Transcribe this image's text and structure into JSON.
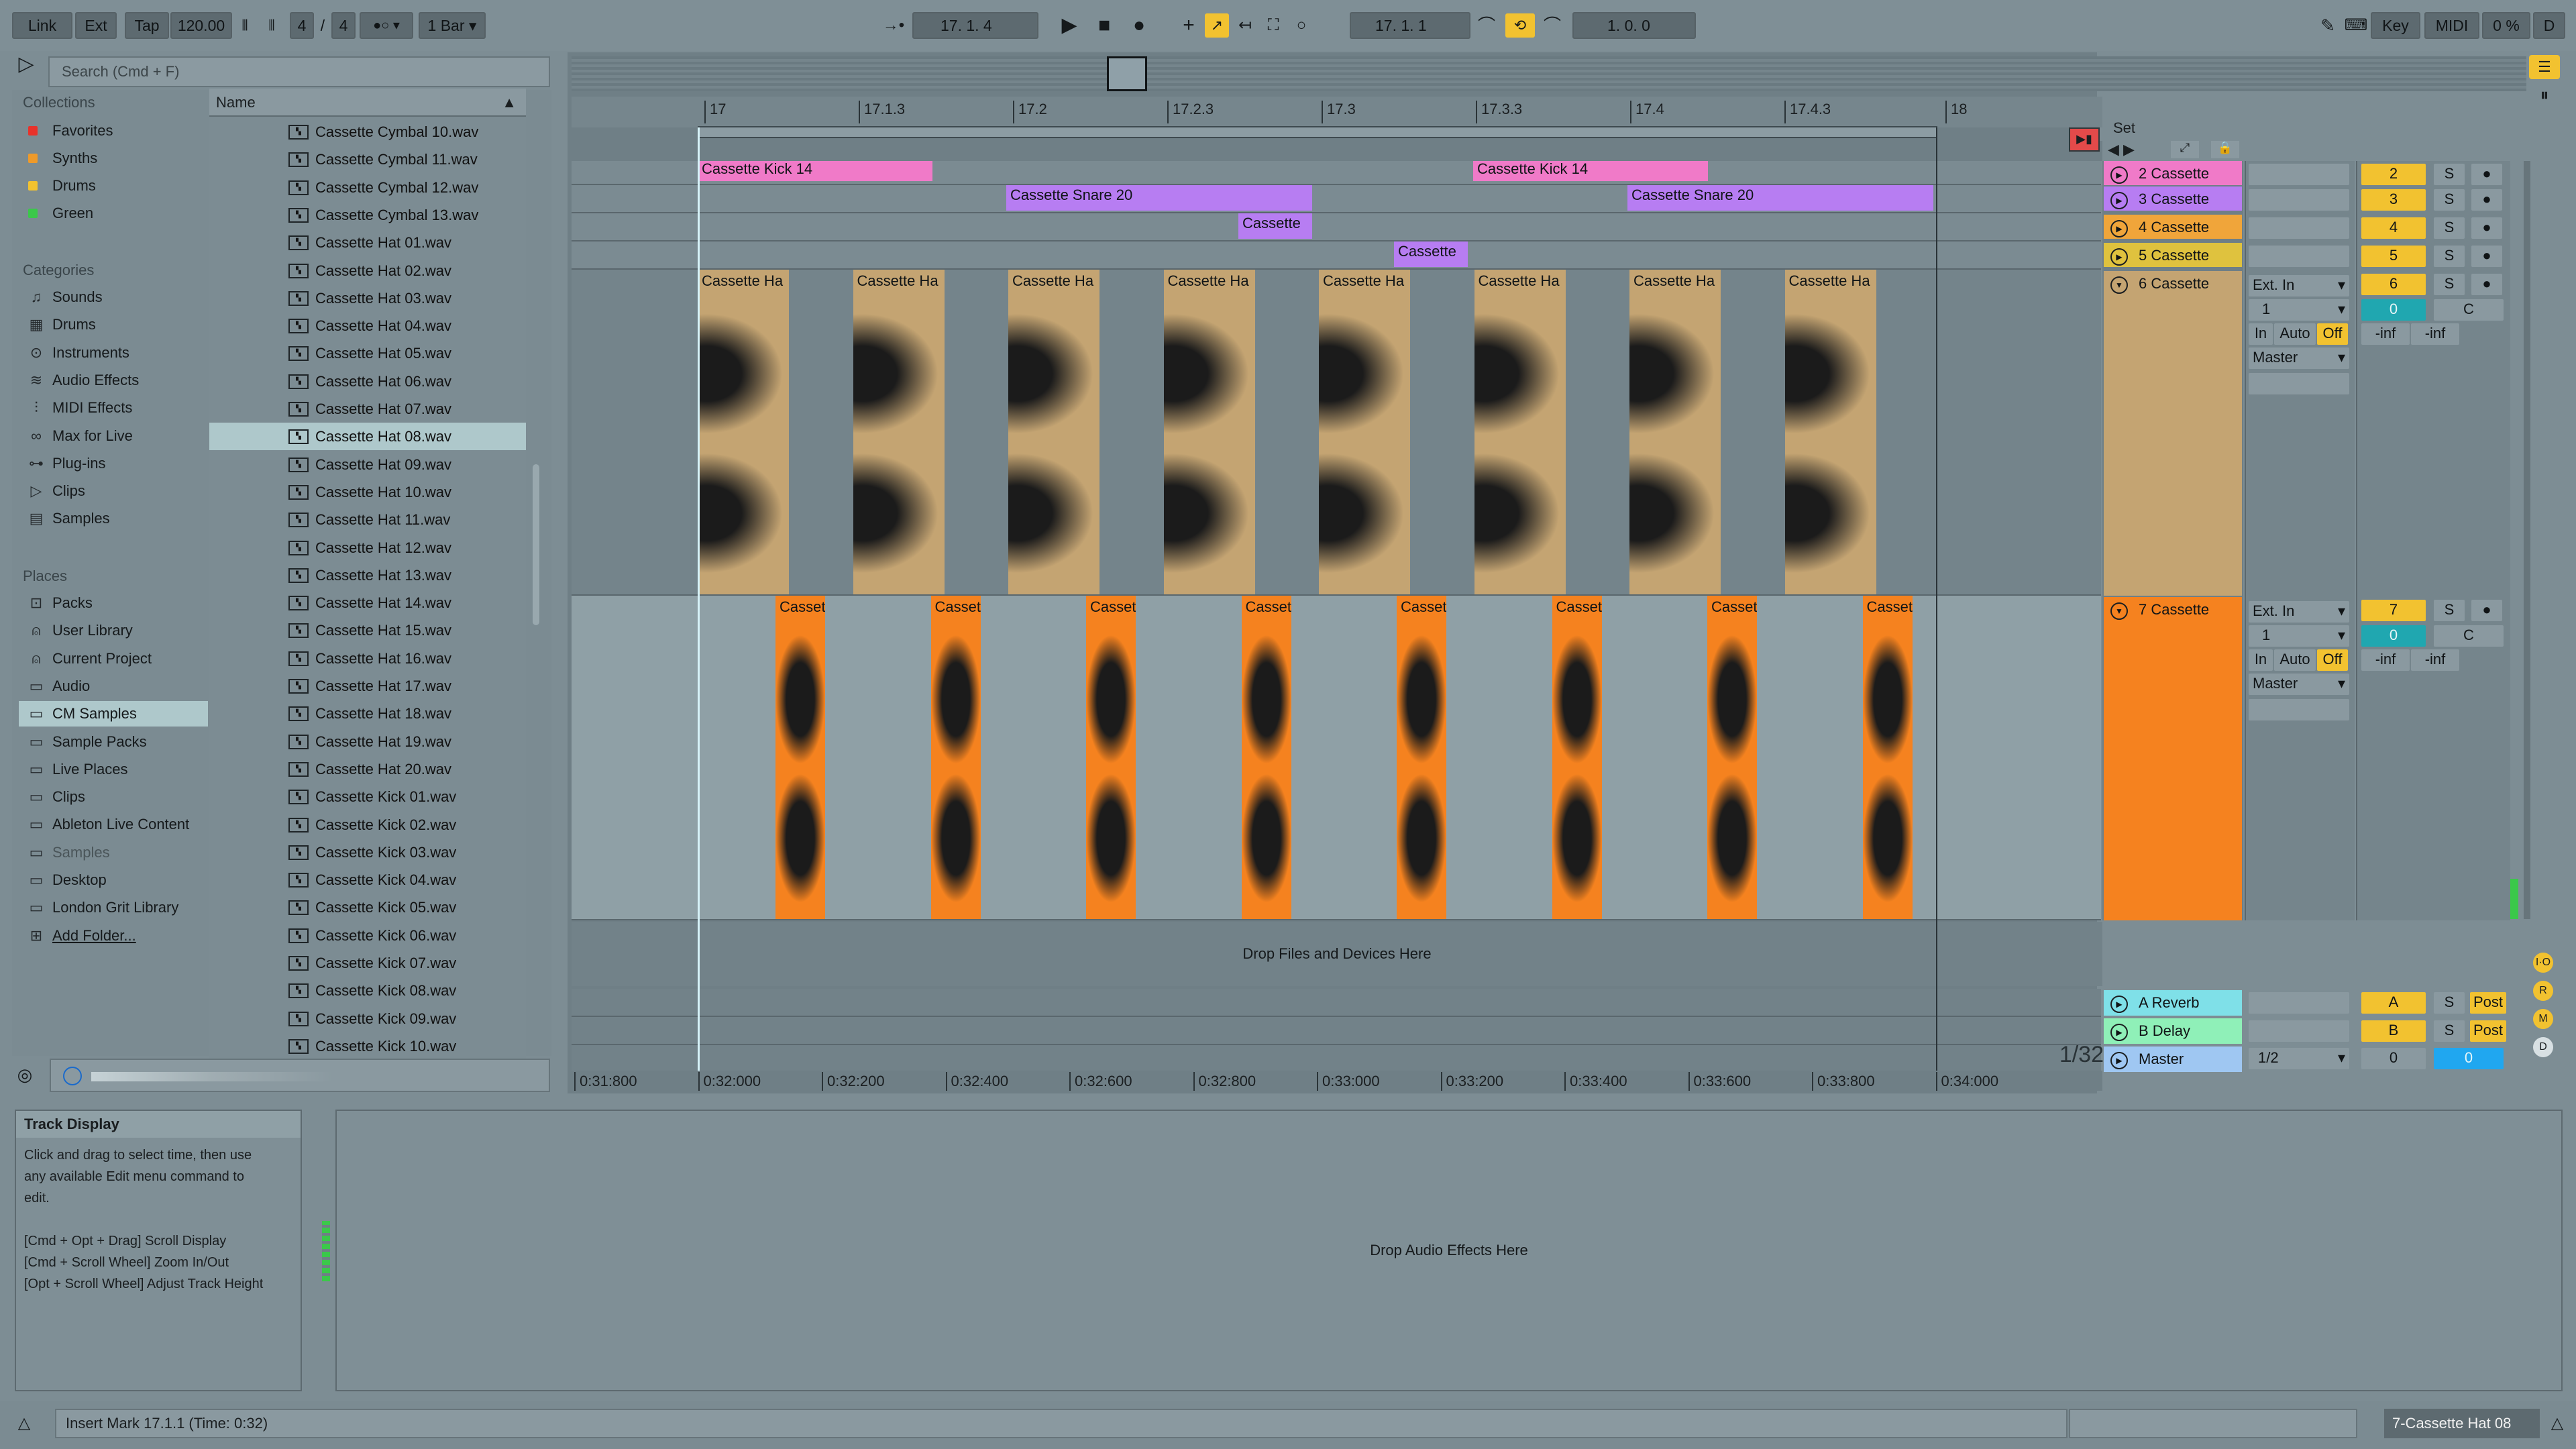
{
  "control_bar": {
    "link": "Link",
    "ext": "Ext",
    "tap": "Tap",
    "tempo": "120.00",
    "sig_num": "4",
    "sig_sep": "/",
    "sig_den": "4",
    "quant": "1 Bar",
    "arr_pos": "17.  1.  4",
    "loop_start": "17.  1.  1",
    "loop_len": "1.  0.  0",
    "key": "Key",
    "midi": "MIDI",
    "cpu": "0 %",
    "d": "D"
  },
  "browser": {
    "search_placeholder": "Search (Cmd + F)",
    "name_header": "Name",
    "collections_title": "Collections",
    "collections": [
      {
        "label": "Favorites",
        "color": "#e8322a"
      },
      {
        "label": "Synths",
        "color": "#ee9a2a"
      },
      {
        "label": "Drums",
        "color": "#f2c230"
      },
      {
        "label": "Green",
        "color": "#3bc84a"
      }
    ],
    "categories_title": "Categories",
    "categories": [
      {
        "label": "Sounds",
        "icon": "music-note-icon"
      },
      {
        "label": "Drums",
        "icon": "drum-grid-icon"
      },
      {
        "label": "Instruments",
        "icon": "instrument-icon"
      },
      {
        "label": "Audio Effects",
        "icon": "audio-effect-icon"
      },
      {
        "label": "MIDI Effects",
        "icon": "midi-effect-icon"
      },
      {
        "label": "Max for Live",
        "icon": "max-icon"
      },
      {
        "label": "Plug-ins",
        "icon": "plugin-icon"
      },
      {
        "label": "Clips",
        "icon": "clip-icon"
      },
      {
        "label": "Samples",
        "icon": "sample-icon"
      }
    ],
    "places_title": "Places",
    "places": [
      "Packs",
      "User Library",
      "Current Project",
      "Audio",
      "CM Samples",
      "Sample Packs",
      "Live Places",
      "Clips",
      "Ableton Live Content",
      "Samples",
      "Desktop",
      "London Grit Library",
      "Add Folder..."
    ],
    "files": [
      "Cassette Cymbal 10.wav",
      "Cassette Cymbal 11.wav",
      "Cassette Cymbal 12.wav",
      "Cassette Cymbal 13.wav",
      "Cassette Hat 01.wav",
      "Cassette Hat 02.wav",
      "Cassette Hat 03.wav",
      "Cassette Hat 04.wav",
      "Cassette Hat 05.wav",
      "Cassette Hat 06.wav",
      "Cassette Hat 07.wav",
      "Cassette Hat 08.wav",
      "Cassette Hat 09.wav",
      "Cassette Hat 10.wav",
      "Cassette Hat 11.wav",
      "Cassette Hat 12.wav",
      "Cassette Hat 13.wav",
      "Cassette Hat 14.wav",
      "Cassette Hat 15.wav",
      "Cassette Hat 16.wav",
      "Cassette Hat 17.wav",
      "Cassette Hat 18.wav",
      "Cassette Hat 19.wav",
      "Cassette Hat 20.wav",
      "Cassette Kick 01.wav",
      "Cassette Kick 02.wav",
      "Cassette Kick 03.wav",
      "Cassette Kick 04.wav",
      "Cassette Kick 05.wav",
      "Cassette Kick 06.wav",
      "Cassette Kick 07.wav",
      "Cassette Kick 08.wav",
      "Cassette Kick 09.wav",
      "Cassette Kick 10.wav"
    ],
    "selected_file": "Cassette Hat 08.wav"
  },
  "arrangement": {
    "ruler": [
      "17",
      "17.1.3",
      "17.2",
      "17.2.3",
      "17.3",
      "17.3.3",
      "17.4",
      "17.4.3",
      "18"
    ],
    "time_ruler": [
      "0:31:800",
      "0:32:000",
      "0:32:200",
      "0:32:400",
      "0:32:600",
      "0:32:800",
      "0:33:000",
      "0:33:200",
      "0:33:400",
      "0:33:600",
      "0:33:800",
      "0:34:000"
    ],
    "set_label": "Set",
    "zoom": "1/32",
    "drop_files": "Drop Files and Devices Here",
    "kick_clip": "Cassette Kick 14",
    "snare_clip": "Cassette Snare 20",
    "short_clip": "Cassette",
    "hat_clip": "Cassette Ha",
    "orange_clip": "Casset"
  },
  "tracks": [
    {
      "name": "2 Cassette",
      "num": "2",
      "color": "#f07ac8"
    },
    {
      "name": "3 Cassette",
      "num": "3",
      "color": "#b77df2"
    },
    {
      "name": "4 Cassette",
      "num": "4",
      "color": "#f0a53a"
    },
    {
      "name": "5 Cassette",
      "num": "5",
      "color": "#dfc23e"
    },
    {
      "name": "6 Cassette",
      "num": "6",
      "color": "#c4a472"
    },
    {
      "name": "7 Cassette",
      "num": "7",
      "color": "#f5821f"
    }
  ],
  "mixer": {
    "ext_in": "Ext. In",
    "chan": "1",
    "in": "In",
    "auto": "Auto",
    "off": "Off",
    "master_out": "Master",
    "vol": "0",
    "pan": "C",
    "inf": "-inf",
    "solo": "S"
  },
  "returns": [
    {
      "name": "A Reverb",
      "letter": "A",
      "color": "#7fe0e8"
    },
    {
      "name": "B Delay",
      "letter": "B",
      "color": "#8ff0b8"
    }
  ],
  "master": {
    "name": "Master",
    "cue": "1/2",
    "vol": "0",
    "pan": "0",
    "post": "Post"
  },
  "info": {
    "title": "Track Display",
    "body1": "Click and drag to select time, then use",
    "body2": "any available Edit menu command to",
    "body3": "edit.",
    "k1": "[Cmd + Opt + Drag] Scroll Display",
    "k2": "[Cmd + Scroll Wheel] Zoom In/Out",
    "k3": "[Opt + Scroll Wheel] Adjust Track Height"
  },
  "device": {
    "drop": "Drop Audio Effects Here"
  },
  "status": {
    "message": "Insert Mark 17.1.1 (Time: 0:32)",
    "track": "7-Cassette Hat 08"
  }
}
